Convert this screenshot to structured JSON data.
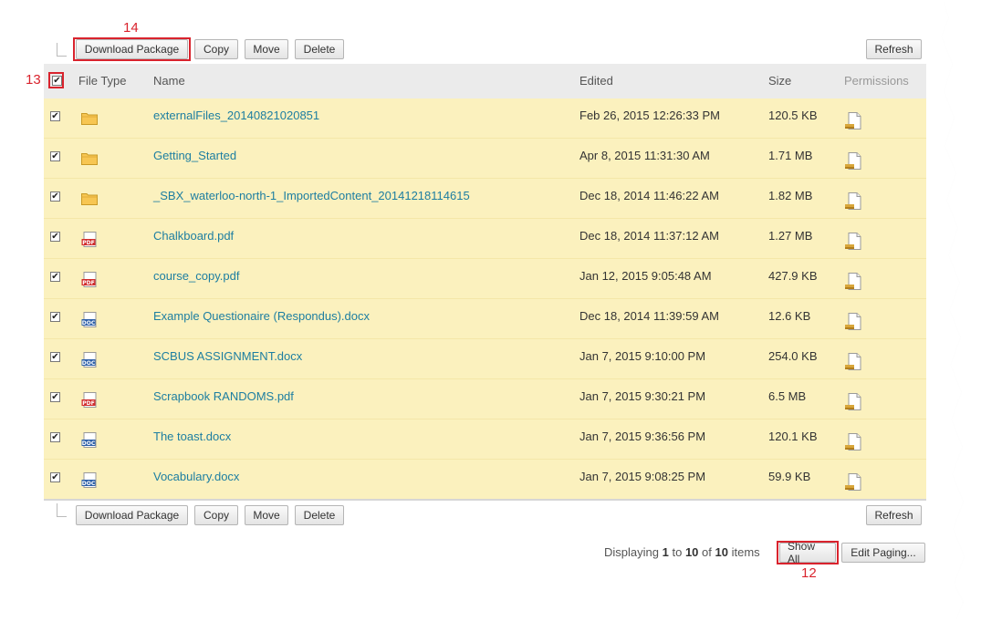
{
  "toolbar_top": {
    "download_label": "Download Package",
    "copy_label": "Copy",
    "move_label": "Move",
    "delete_label": "Delete",
    "refresh_label": "Refresh"
  },
  "toolbar_bottom": {
    "download_label": "Download Package",
    "copy_label": "Copy",
    "move_label": "Move",
    "delete_label": "Delete",
    "refresh_label": "Refresh"
  },
  "callouts": {
    "c14": "14",
    "c13": "13",
    "c12": "12"
  },
  "table": {
    "headers": {
      "file_type": "File Type",
      "name": "Name",
      "edited": "Edited",
      "size": "Size",
      "permissions": "Permissions"
    },
    "rows": [
      {
        "icon": "folder-icon",
        "name": "externalFiles_20140821020851",
        "edited": "Feb 26, 2015 12:26:33 PM",
        "size": "120.5 KB",
        "checked": true
      },
      {
        "icon": "folder-icon",
        "name": "Getting_Started",
        "edited": "Apr 8, 2015 11:31:30 AM",
        "size": "1.71 MB",
        "checked": true
      },
      {
        "icon": "folder-icon",
        "name": "_SBX_waterloo-north-1_ImportedContent_20141218114615",
        "edited": "Dec 18, 2014 11:46:22 AM",
        "size": "1.82 MB",
        "checked": true
      },
      {
        "icon": "pdf-icon",
        "name": "Chalkboard.pdf",
        "edited": "Dec 18, 2014 11:37:12 AM",
        "size": "1.27 MB",
        "checked": true
      },
      {
        "icon": "pdf-icon",
        "name": "course_copy.pdf",
        "edited": "Jan 12, 2015 9:05:48 AM",
        "size": "427.9 KB",
        "checked": true
      },
      {
        "icon": "doc-icon",
        "name": "Example Questionaire (Respondus).docx",
        "edited": "Dec 18, 2014 11:39:59 AM",
        "size": "12.6 KB",
        "checked": true
      },
      {
        "icon": "doc-icon",
        "name": "SCBUS ASSIGNMENT.docx",
        "edited": "Jan 7, 2015 9:10:00 PM",
        "size": "254.0 KB",
        "checked": true
      },
      {
        "icon": "pdf-icon",
        "name": "Scrapbook RANDOMS.pdf",
        "edited": "Jan 7, 2015 9:30:21 PM",
        "size": "6.5 MB",
        "checked": true
      },
      {
        "icon": "doc-icon",
        "name": "The toast.docx",
        "edited": "Jan 7, 2015 9:36:56 PM",
        "size": "120.1 KB",
        "checked": true
      },
      {
        "icon": "doc-icon",
        "name": "Vocabulary.docx",
        "edited": "Jan 7, 2015 9:08:25 PM",
        "size": "59.9 KB",
        "checked": true
      }
    ]
  },
  "paging": {
    "displaying": "Displaying",
    "from": "1",
    "to_word": "to",
    "to": "10",
    "of_word": "of",
    "total": "10",
    "items_word": "items",
    "show_all_label": "Show All",
    "edit_paging_label": "Edit Paging..."
  },
  "colors": {
    "row_bg": "#fbf1be",
    "header_bg": "#ebebeb",
    "link": "#1d7ea1",
    "callout": "#d9232d"
  }
}
